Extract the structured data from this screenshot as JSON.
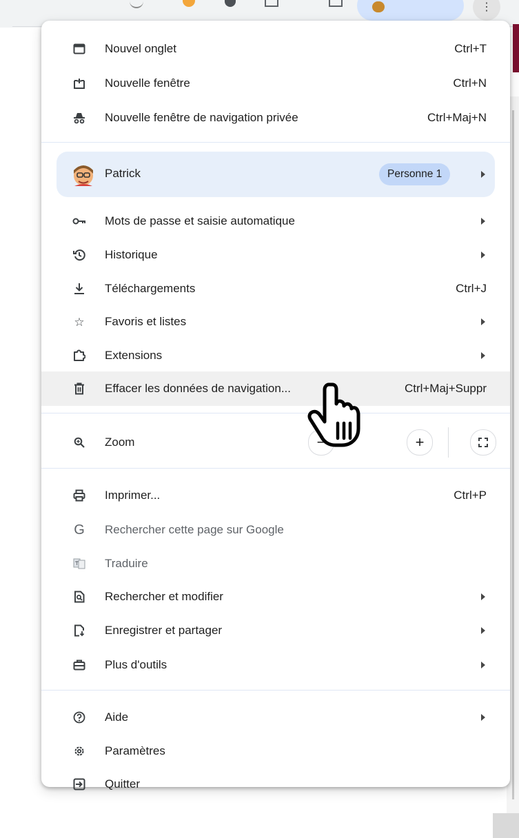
{
  "menu": {
    "group1": [
      {
        "label": "Nouvel onglet",
        "shortcut": "Ctrl+T",
        "icon": "new-tab-icon"
      },
      {
        "label": "Nouvelle fenêtre",
        "shortcut": "Ctrl+N",
        "icon": "new-window-icon"
      },
      {
        "label": "Nouvelle fenêtre de navigation privée",
        "shortcut": "Ctrl+Maj+N",
        "icon": "incognito-icon"
      }
    ],
    "profile": {
      "name": "Patrick",
      "badge": "Personne 1",
      "icon": "avatar-icon"
    },
    "group2": [
      {
        "label": "Mots de passe et saisie automatique",
        "icon": "key-icon",
        "submenu": true
      },
      {
        "label": "Historique",
        "icon": "history-icon",
        "submenu": true
      },
      {
        "label": "Téléchargements",
        "shortcut": "Ctrl+J",
        "icon": "download-icon"
      },
      {
        "label": "Favoris et listes",
        "icon": "star-icon",
        "submenu": true
      },
      {
        "label": "Extensions",
        "icon": "puzzle-icon",
        "submenu": true
      },
      {
        "label": "Effacer les données de navigation...",
        "shortcut": "Ctrl+Maj+Suppr",
        "icon": "trash-icon",
        "hovered": true
      }
    ],
    "zoom": {
      "label": "Zoom",
      "minus": "−",
      "plus": "+",
      "icon": "zoom-icon"
    },
    "group3": [
      {
        "label": "Imprimer...",
        "shortcut": "Ctrl+P",
        "icon": "print-icon"
      },
      {
        "label": "Rechercher cette page sur Google",
        "icon": "google-icon",
        "muted": true
      },
      {
        "label": "Traduire",
        "icon": "translate-icon",
        "muted": true
      },
      {
        "label": "Rechercher et modifier",
        "icon": "find-edit-icon",
        "submenu": true
      },
      {
        "label": "Enregistrer et partager",
        "icon": "save-share-icon",
        "submenu": true
      },
      {
        "label": "Plus d'outils",
        "icon": "toolbox-icon",
        "submenu": true
      }
    ],
    "group4": [
      {
        "label": "Aide",
        "icon": "help-icon",
        "submenu": true
      },
      {
        "label": "Paramètres",
        "icon": "settings-icon"
      },
      {
        "label": "Quitter",
        "icon": "exit-icon"
      }
    ]
  },
  "colors": {
    "accent": "#d3e3fd",
    "profile_row": "#e7effa",
    "hover_row": "#f0f0f0",
    "text": "#1f1f1f",
    "muted_text": "#5f6368"
  }
}
